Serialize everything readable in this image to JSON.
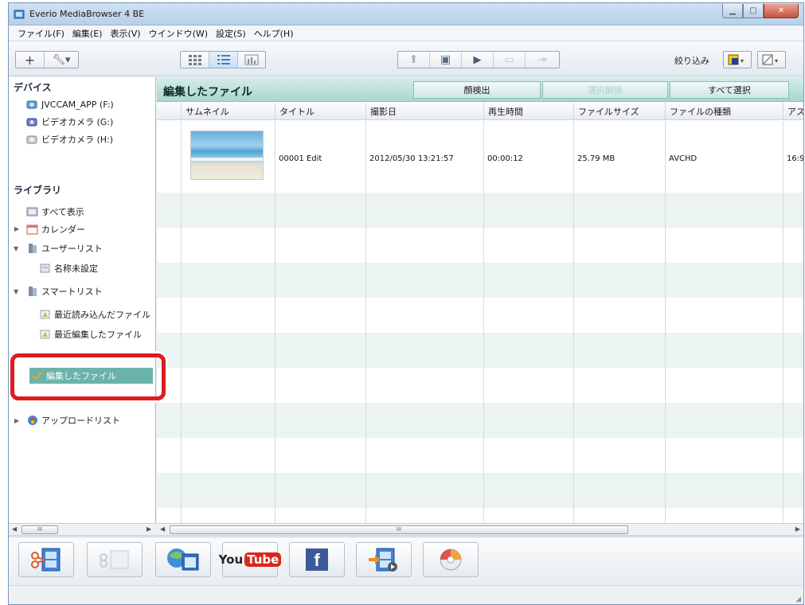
{
  "window": {
    "title": "Everio MediaBrowser 4 BE"
  },
  "menu": [
    "ファイル(F)",
    "編集(E)",
    "表示(V)",
    "ウインドウ(W)",
    "設定(S)",
    "ヘルプ(H)"
  ],
  "toolbar": {
    "filter_label": "絞り込み"
  },
  "sidebar": {
    "devices_heading": "デバイス",
    "devices": [
      "JVCCAM_APP (F:)",
      "ビデオカメラ (G:)",
      "ビデオカメラ (H:)"
    ],
    "library_heading": "ライブラリ",
    "library": {
      "all": "すべて表示",
      "calendar": "カレンダー",
      "user_list": "ユーザーリスト",
      "untitled": "名称未設定",
      "smart_list": "スマートリスト",
      "recent_imported": "最近読み込んだファイル",
      "recent_edited": "最近編集したファイル",
      "edited_files": "編集したファイル",
      "upload_list": "アップロードリスト"
    }
  },
  "main": {
    "title": "編集したファイル",
    "buttons": {
      "face_detect": "顔検出",
      "unselect": "選択解除",
      "select_all": "すべて選択"
    },
    "columns": [
      "サムネイル",
      "タイトル",
      "撮影日",
      "再生時間",
      "ファイルサイズ",
      "ファイルの種類",
      "アス"
    ],
    "rows": [
      {
        "title": "00001 Edit",
        "date": "2012/05/30 13:21:57",
        "duration": "00:00:12",
        "size": "25.79 MB",
        "type": "AVCHD",
        "aspect": "16:9"
      }
    ]
  },
  "scroll": {
    "thumb_label": "III"
  },
  "actions": {
    "youtube_you": "You",
    "youtube_tube": "Tube",
    "facebook": "f"
  },
  "colors": {
    "accent_teal": "#6bb3aa",
    "highlight_red": "#dd1c22",
    "header_teal": "#a9d6cf"
  }
}
